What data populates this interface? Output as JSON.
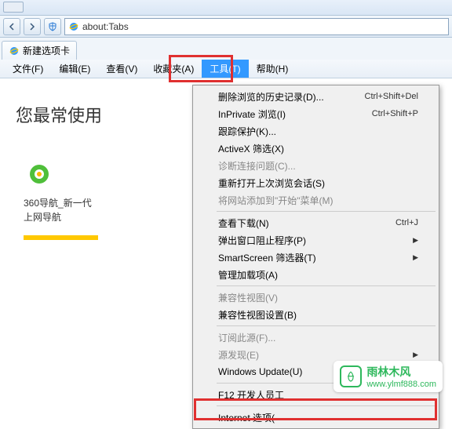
{
  "address_bar": {
    "url": "about:Tabs"
  },
  "tab": {
    "title": "新建选项卡"
  },
  "menu": {
    "file": "文件(F)",
    "edit": "编辑(E)",
    "view": "查看(V)",
    "favorites": "收藏夹(A)",
    "tools": "工具(T)",
    "help": "帮助(H)"
  },
  "dropdown": {
    "delete_history": "删除浏览的历史记录(D)...",
    "delete_history_sc": "Ctrl+Shift+Del",
    "inprivate": "InPrivate 浏览(I)",
    "inprivate_sc": "Ctrl+Shift+P",
    "tracking": "跟踪保护(K)...",
    "activex": "ActiveX 筛选(X)",
    "diagnose": "诊断连接问题(C)...",
    "reopen": "重新打开上次浏览会话(S)",
    "add_start": "将网站添加到\"开始\"菜单(M)",
    "downloads": "查看下载(N)",
    "downloads_sc": "Ctrl+J",
    "popup": "弹出窗口阻止程序(P)",
    "smartscreen": "SmartScreen 筛选器(T)",
    "addons": "管理加载项(A)",
    "compat_view": "兼容性视图(V)",
    "compat_settings": "兼容性视图设置(B)",
    "subscribe": "订阅此源(F)...",
    "feed_discovery": "源发现(E)",
    "windows_update": "Windows Update(U)",
    "f12": "F12 开发人员工",
    "internet_options": "Internet 选项("
  },
  "content": {
    "heading": "您最常使用",
    "bookmark_title": "360导航_新一代\n上网导航"
  },
  "watermark": {
    "cn": "雨林木风",
    "url": "www.ylmf888.com"
  }
}
